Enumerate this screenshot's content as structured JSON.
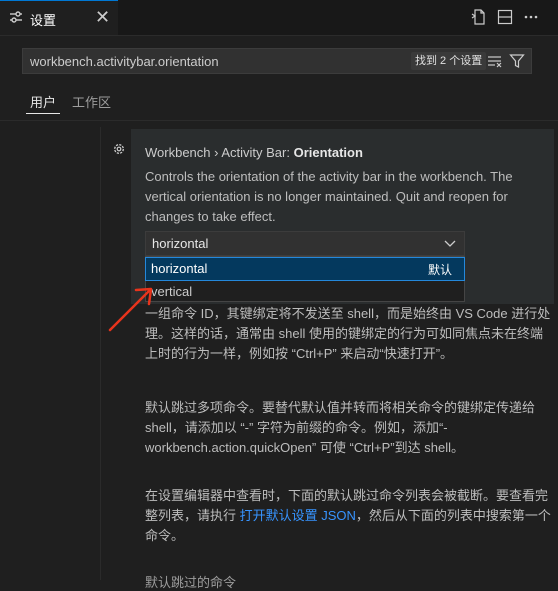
{
  "tab": {
    "title": "设置",
    "close": "✕",
    "icon": "settings-sliders-icon"
  },
  "toolbar": {
    "icons": [
      "open-settings-json-icon",
      "split-editor-icon",
      "more-actions-icon"
    ]
  },
  "search": {
    "value": "workbench.activitybar.orientation",
    "count_badge": "找到 2 个设置",
    "icons": [
      "clear-filter-icon",
      "filter-icon"
    ]
  },
  "scope_tabs": {
    "user": "用户",
    "workspace": "工作区"
  },
  "setting": {
    "category": "Workbench › Activity Bar: ",
    "name": "Orientation",
    "description": "Controls the orientation of the activity bar in the workbench. The vertical orientation is no longer maintained. Quit and reopen for changes to take effect.",
    "selected": "horizontal",
    "options": [
      {
        "label": "horizontal",
        "badge": "默认"
      },
      {
        "label": "vertical",
        "badge": ""
      }
    ]
  },
  "following_text": {
    "p1": "一组命令 ID，其键绑定将不发送至 shell，而是始终由 VS Code 进行处理。这样的话，通常由 shell 使用的键绑定的行为可如同焦点未在终端上时的行为一样，例如按 “Ctrl+P” 来启动“快速打开”。",
    "p2": "默认跳过多项命令。要替代默认值并转而将相关命令的键绑定传递给 shell，请添加以 “-” 字符为前缀的命令。例如，添加“-workbench.action.quickOpen” 可使 “Ctrl+P”到达 shell。",
    "p3_before": "在设置编辑器中查看时，下面的默认跳过命令列表会被截断。要查看完整列表，请执行 ",
    "p3_link": "打开默认设置 JSON",
    "p3_after": "，然后从下面的列表中搜索第一个命令。",
    "bottom_partial": "默认跳过的命令"
  },
  "colors": {
    "accent": "#0078d4",
    "link": "#3794ff",
    "arrow": "#e8341c",
    "selection": "#04395e"
  }
}
